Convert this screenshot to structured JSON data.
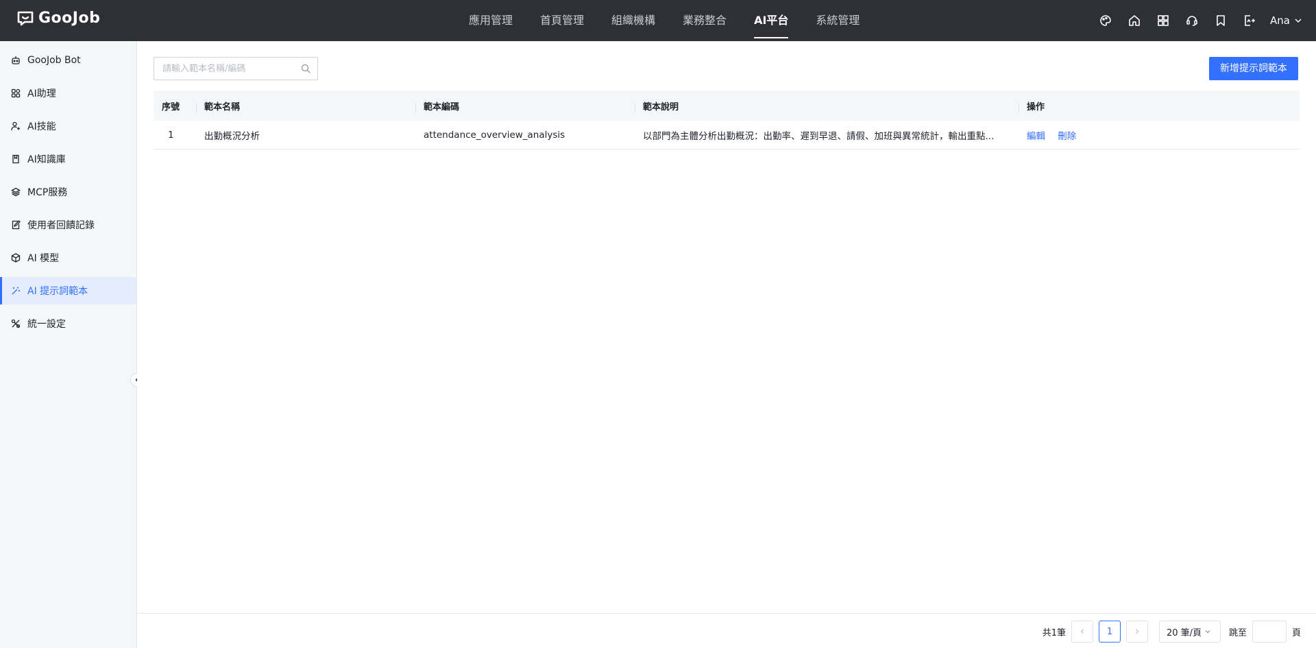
{
  "app": {
    "logo_text": "GooJob"
  },
  "nav": {
    "items": [
      "應用管理",
      "首頁管理",
      "組織機構",
      "業務整合",
      "AI平台",
      "系統管理"
    ],
    "active_index": 4
  },
  "header": {
    "user_name": "Ana"
  },
  "sidebar": {
    "items": [
      {
        "label": "GooJob Bot",
        "icon": "robot-icon"
      },
      {
        "label": "AI助理",
        "icon": "apps-icon"
      },
      {
        "label": "AI技能",
        "icon": "skill-icon"
      },
      {
        "label": "AI知識庫",
        "icon": "book-icon"
      },
      {
        "label": "MCP服務",
        "icon": "layers-icon"
      },
      {
        "label": "使用者回饋記錄",
        "icon": "feedback-icon"
      },
      {
        "label": "AI 模型",
        "icon": "cube-icon"
      },
      {
        "label": "AI 提示詞範本",
        "icon": "magic-wand-icon"
      },
      {
        "label": "統一設定",
        "icon": "tools-icon"
      }
    ],
    "active_index": 7
  },
  "toolbar": {
    "search_placeholder": "請輸入範本名稱/編碼",
    "add_button": "新增提示詞範本"
  },
  "table": {
    "columns": [
      "序號",
      "範本名稱",
      "範本編碼",
      "範本說明",
      "操作"
    ],
    "rows": [
      {
        "index": "1",
        "name": "出勤概況分析",
        "code": "attendance_overview_analysis",
        "description": "以部門為主體分析出勤概況：出勤率、遲到早退、請假、加班與異常統計，輸出重點...",
        "actions": [
          "編輯",
          "刪除"
        ]
      }
    ]
  },
  "pagination": {
    "total_text": "共1筆",
    "current_page": "1",
    "page_size": "20 筆/頁",
    "jump_label": "跳至",
    "page_suffix": "頁"
  },
  "colors": {
    "accent": "#3370ff",
    "topbar": "#2e3035",
    "sidebar_bg": "#f5f6f7"
  }
}
